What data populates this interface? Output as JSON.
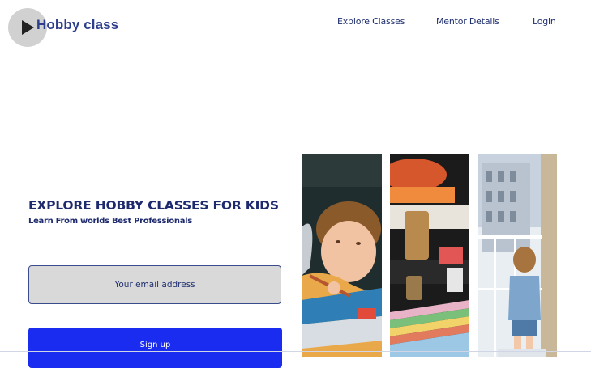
{
  "brand": {
    "name": "Hobby class"
  },
  "nav": {
    "explore": "Explore Classes",
    "mentor": "Mentor Details",
    "login": "Login"
  },
  "hero": {
    "title": "EXPLORE HOBBY CLASSES FOR KIDS",
    "subtitle": "Learn From worlds Best Professionals"
  },
  "form": {
    "email_placeholder": "Your email address",
    "signup_label": "Sign up"
  },
  "colors": {
    "brand_text": "#2c3e8c",
    "primary_button": "#1a2cf0",
    "field_bg": "#d9d9d9"
  },
  "icons": {
    "overlay": "play-icon"
  }
}
